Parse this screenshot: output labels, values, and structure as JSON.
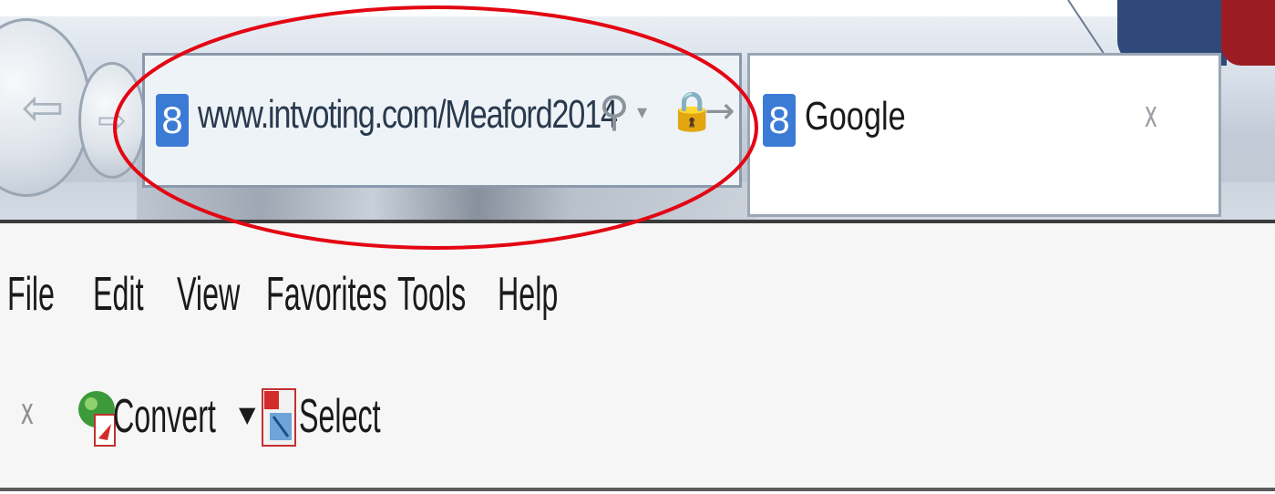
{
  "navigation": {
    "back_icon": "back-arrow-icon",
    "forward_icon": "forward-arrow-icon",
    "back_glyph": "⇦",
    "forward_glyph": "⇨"
  },
  "address_bar": {
    "favicon_glyph": "8",
    "url": "www.intvoting.com/Meaford2014",
    "search_glyph": "⚲",
    "dropdown_glyph": "▾",
    "lock_glyph": "🔒",
    "go_glyph": "→",
    "icons": [
      "search-icon",
      "dropdown-arrow-icon",
      "lock-icon",
      "go-arrow-icon"
    ]
  },
  "search_bar": {
    "favicon_glyph": "8",
    "provider": "Google",
    "close_glyph": "x"
  },
  "menubar": {
    "items": [
      "File",
      "Edit",
      "View",
      "Favorites",
      "Tools",
      "Help"
    ]
  },
  "command_bar": {
    "close_glyph": "x",
    "convert_label": "Convert",
    "convert_caret": "▼",
    "select_label": "Select"
  },
  "colors": {
    "highlight_ellipse": "#e30613",
    "accent_navy": "#2f4a7a",
    "accent_red": "#9b1d23",
    "google_blue": "#3b7bd6"
  }
}
